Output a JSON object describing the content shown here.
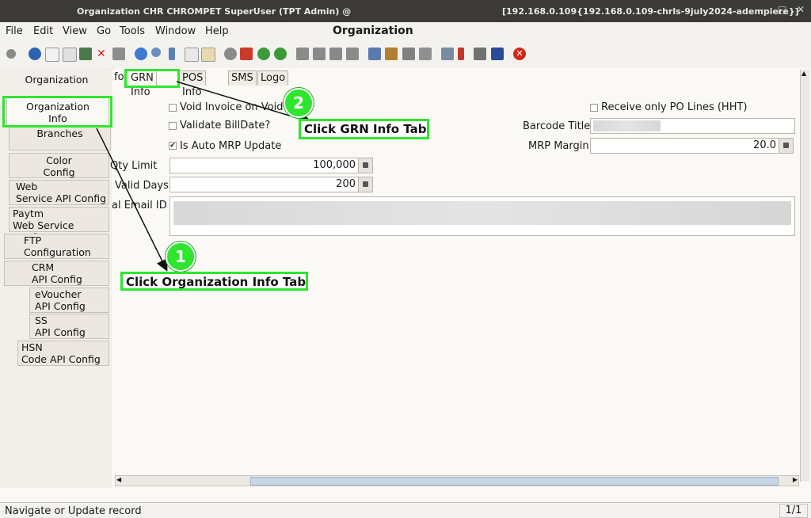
{
  "window": {
    "title_left": "Organization  CHR  CHROMPET  SuperUser (TPT Admin) @",
    "title_right": "[192.168.0.109{192.168.0.109-chrls-9july2024-adempiere}]",
    "min_glyph": "–",
    "max_glyph": "□",
    "close_glyph": "✕"
  },
  "menu": [
    "File",
    "Edit",
    "View",
    "Go",
    "Tools",
    "Window",
    "Help"
  ],
  "form_title": "Organization",
  "toolbar_icons": [
    "undo-icon",
    "help-icon",
    "new-icon",
    "copy-icon",
    "save-icon",
    "delete-icon",
    "save-alt-icon",
    "refresh-icon",
    "find-icon",
    "attachment-icon",
    "chat-icon",
    "history-icon",
    "home-icon",
    "previous-icon",
    "next-icon",
    "first-record-icon",
    "up-icon",
    "down-icon",
    "last-record-icon",
    "report-icon",
    "archive-icon",
    "print-preview-icon",
    "print-icon",
    "zoom-across-icon",
    "workflow-icon",
    "product-info-icon",
    "end-icon",
    "close-window-icon"
  ],
  "left_tabs": [
    "Organization",
    "Organization\nInfo",
    "Branches",
    "Color\nConfig",
    "Web\nService API Config",
    "Paytm\nWeb Service Config",
    "FTP\nConfiguration",
    "CRM\nAPI Config",
    "eVoucher\nAPI Config",
    "SS\nAPI Config",
    "HSN\nCode API Config"
  ],
  "detail_tabs": [
    "fo",
    "GRN Info",
    "POS Info",
    "SMS",
    "Logo"
  ],
  "fields": {
    "void_invoice": "Void Invoice on Void G",
    "validate_billdate": "Validate BillDate?",
    "auto_mrp": "Is Auto MRP Update",
    "auto_mrp_checkmark": "✔",
    "qty_limit_label": "Qty Limit",
    "qty_limit_value": "100,000",
    "valid_days_label": "Valid Days",
    "valid_days_value": "200",
    "email_label": "al Email ID",
    "receive_po": "Receive only PO Lines (HHT)",
    "barcode_title_label": "Barcode Title",
    "mrp_margin_label": "MRP Margin",
    "mrp_margin_value": "20.0"
  },
  "status": {
    "message": "Navigate or Update record",
    "count": "1/1"
  },
  "annotations": {
    "step1_number": "1",
    "step1_text": "Click Organization Info Tab",
    "step2_number": "2",
    "step2_text": "Click GRN Info Tab",
    "color": "#2ee62e"
  },
  "scroll_glyphs": {
    "up": "▲",
    "down": "▼",
    "left": "◀",
    "right": "▶"
  }
}
